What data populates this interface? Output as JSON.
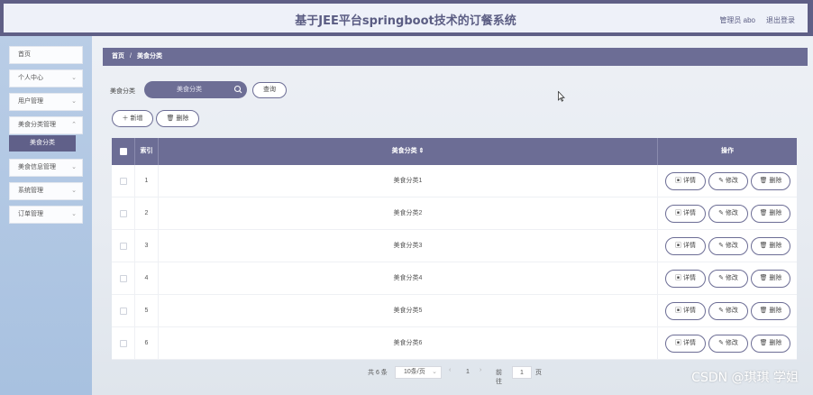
{
  "header": {
    "title": "基于JEE平台springboot技术的订餐系统",
    "user": "管理员 abo",
    "logout": "退出登录"
  },
  "sidebar": {
    "items": [
      {
        "label": "首页",
        "has_children": false
      },
      {
        "label": "个人中心",
        "has_children": true
      },
      {
        "label": "用户管理",
        "has_children": true
      },
      {
        "label": "美食分类管理",
        "has_children": true,
        "expanded": true
      },
      {
        "label": "美食信息管理",
        "has_children": true
      },
      {
        "label": "系统管理",
        "has_children": true
      },
      {
        "label": "订单管理",
        "has_children": true
      }
    ],
    "active_sub_item": "美食分类"
  },
  "breadcrumb": {
    "home": "首页",
    "separator": "/",
    "current": "美食分类"
  },
  "search": {
    "label": "美食分类",
    "placeholder": "美食分类",
    "query_button": "查询"
  },
  "actions": {
    "add": "新增",
    "delete": "删除"
  },
  "table": {
    "headers": {
      "index": "索引",
      "category": "美食分类",
      "operation": "操作"
    },
    "rows": [
      {
        "index": "1",
        "category": "美食分类1"
      },
      {
        "index": "2",
        "category": "美食分类2"
      },
      {
        "index": "3",
        "category": "美食分类3"
      },
      {
        "index": "4",
        "category": "美食分类4"
      },
      {
        "index": "5",
        "category": "美食分类5"
      },
      {
        "index": "6",
        "category": "美食分类6"
      }
    ],
    "row_actions": {
      "detail": "详情",
      "edit": "修改",
      "delete": "删除"
    }
  },
  "pagination": {
    "total": "共 6 条",
    "page_size": "10条/页",
    "current_page": "1",
    "goto_label": "前往",
    "goto_value": "1",
    "page_suffix": "页"
  },
  "watermark": "CSDN @琪琪 学姐",
  "colors": {
    "accent": "#6c6d95",
    "header_bar": "#5f5f86",
    "sidebar_bg": "#b0c6e3",
    "title_text": "#5b5d83"
  }
}
